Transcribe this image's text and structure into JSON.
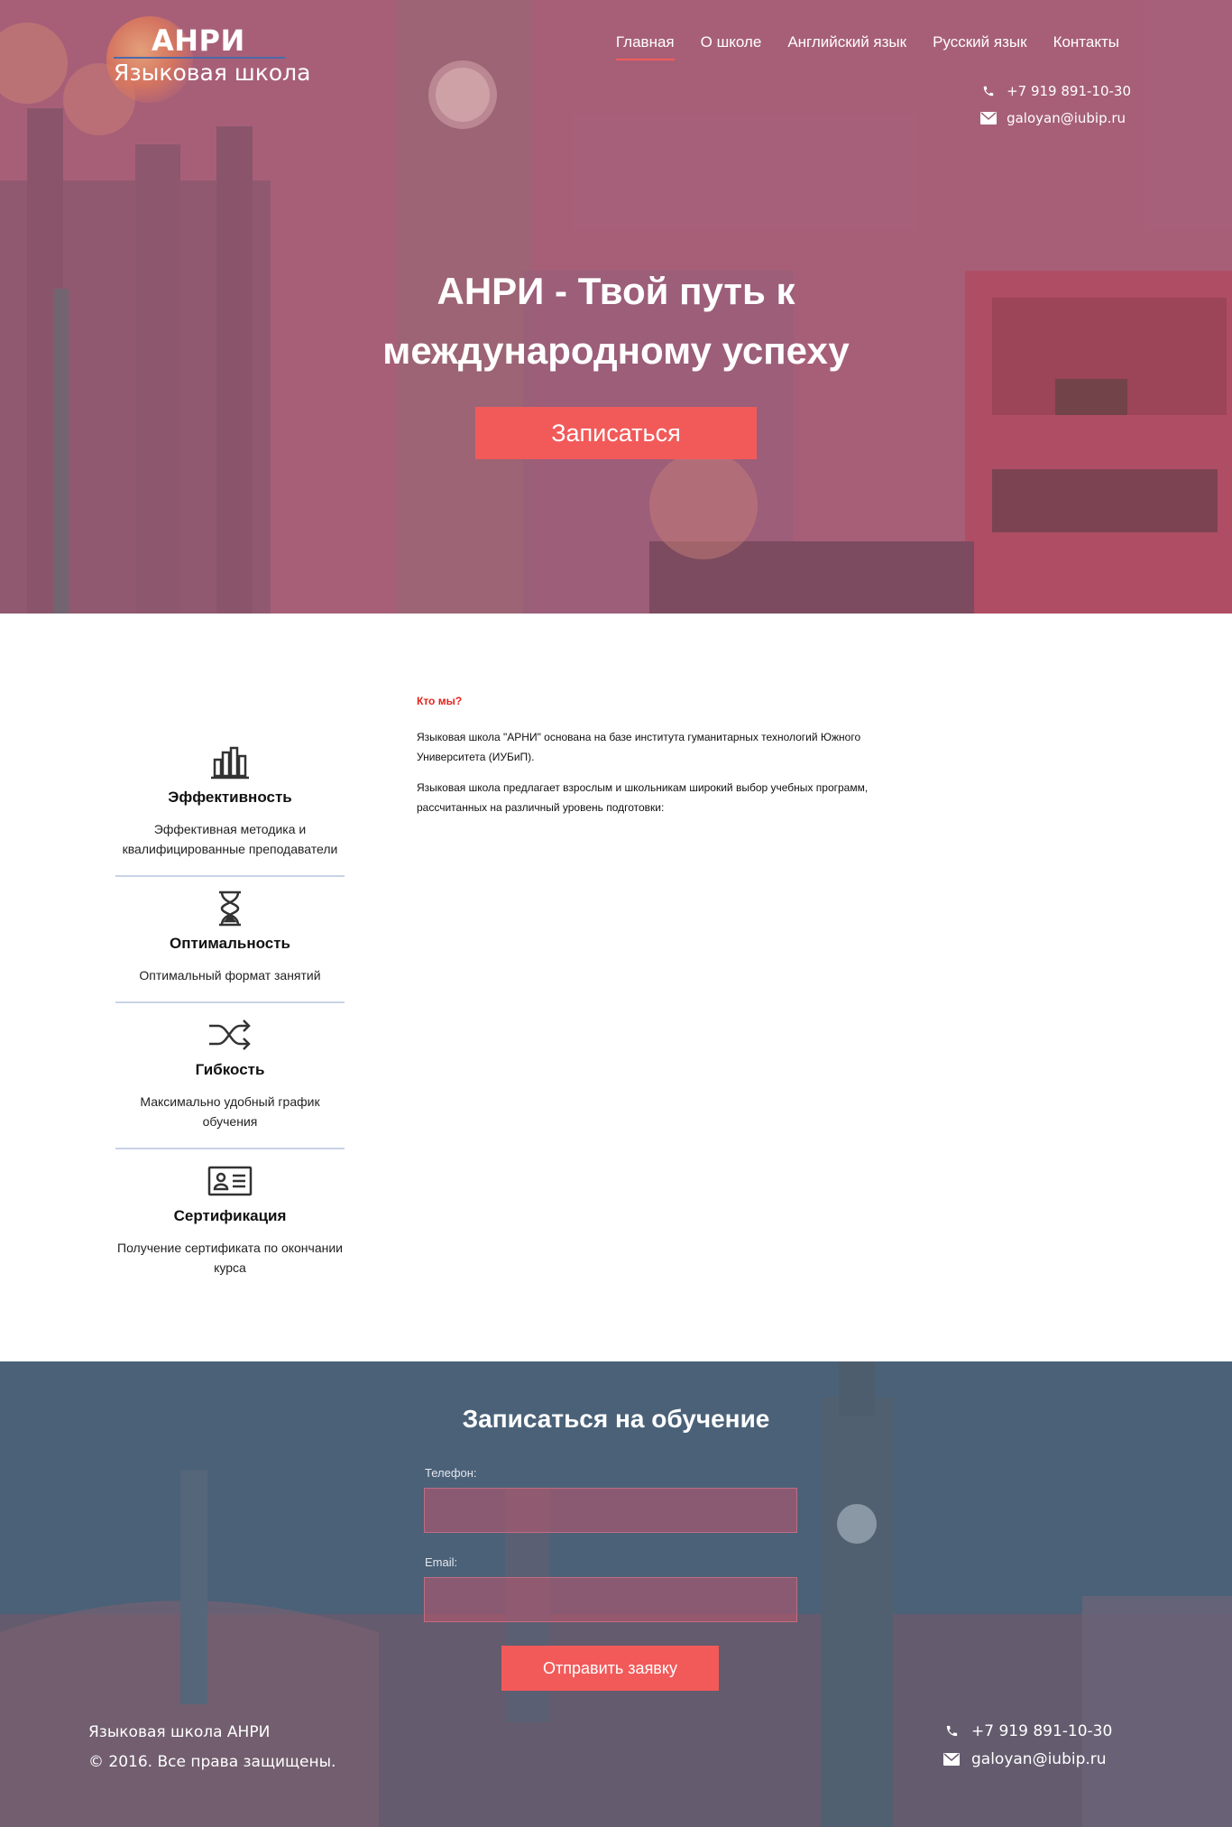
{
  "logo": {
    "title": "АНРИ",
    "subtitle": "Языковая школа"
  },
  "nav": {
    "items": [
      {
        "label": "Главная",
        "active": true
      },
      {
        "label": "О школе"
      },
      {
        "label": "Английский язык"
      },
      {
        "label": "Русский язык"
      },
      {
        "label": "Контакты"
      }
    ]
  },
  "contacts": {
    "phone": "+7 919 891-10-30",
    "email": "galoyan@iubip.ru",
    "phone_icon": "phone-icon",
    "email_icon": "envelope-icon"
  },
  "hero": {
    "title_line1": "АНРИ - Твой путь к",
    "title_line2": "международному успеху",
    "button": "Записаться"
  },
  "features": [
    {
      "icon": "bar-chart-icon",
      "title": "Эффективность",
      "text": "Эффективная методика и квалифицированные преподаватели"
    },
    {
      "icon": "hourglass-icon",
      "title": "Оптимальность",
      "text": "Оптимальный формат занятий"
    },
    {
      "icon": "shuffle-icon",
      "title": "Гибкость",
      "text": "Максимально удобный график обучения"
    },
    {
      "icon": "id-card-icon",
      "title": "Сертификация",
      "text": "Получение сертификата по окончании курса"
    }
  ],
  "about": {
    "heading": "Кто мы?",
    "paragraph1": "Языковая школа \"АРНИ\" основана на базе института гуманитарных технологий Южного Университета (ИУБиП).",
    "paragraph2": "Языковая школа предлагает взрослым и школьникам широкий выбор учебных программ, рассчитанных на различный уровень подготовки:"
  },
  "signup": {
    "title": "Записаться на обучение",
    "phone_label": "Телефон:",
    "phone_value": "",
    "email_label": "Email:",
    "email_value": "",
    "submit": "Отправить заявку"
  },
  "footer": {
    "school_name": "Языковая школа АНРИ",
    "copyright": "© 2016. Все права защищены.",
    "phone": "+7 919 891-10-30",
    "email": "galoyan@iubip.ru"
  },
  "colors": {
    "accent": "#f25a5a",
    "about_heading": "#e2231a",
    "divider": "#c9d3e6"
  }
}
